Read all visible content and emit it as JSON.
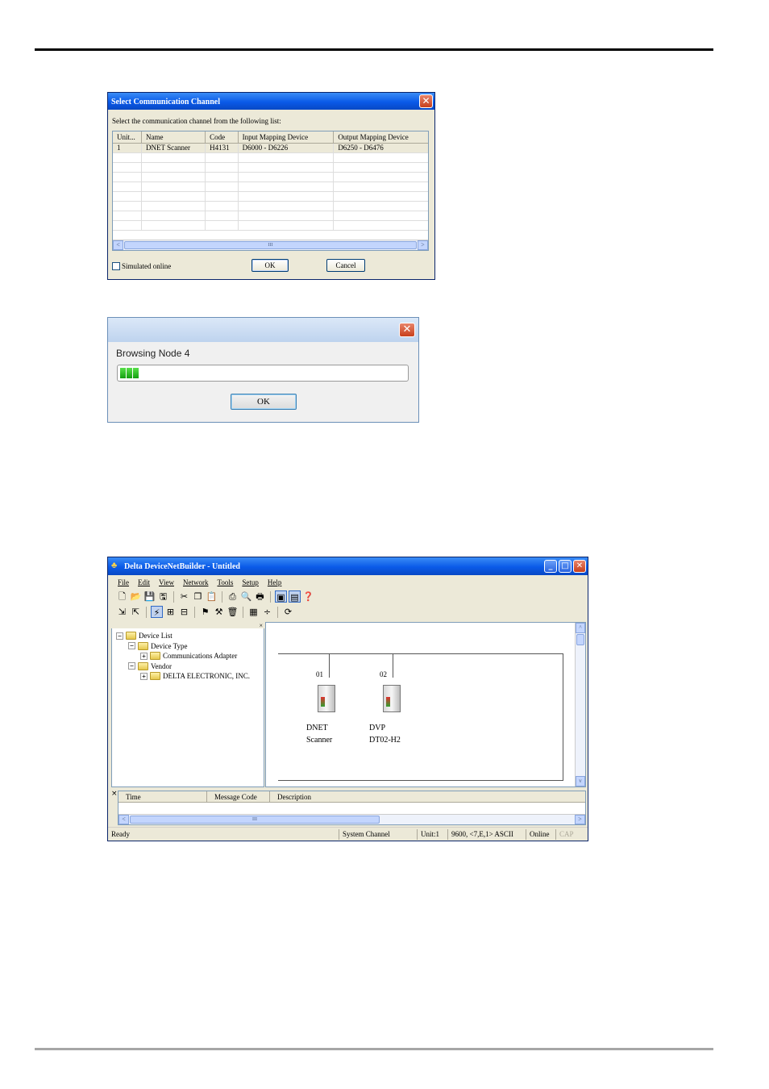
{
  "dialog1": {
    "title": "Select Communication Channel",
    "prompt": "Select the communication channel from the following list:",
    "columns": [
      "Unit...",
      "Name",
      "Code",
      "Input Mapping Device",
      "Output Mapping Device"
    ],
    "rows": [
      [
        "1",
        "DNET Scanner",
        "H4131",
        "D6000 - D6226",
        "D6250 - D6476"
      ]
    ],
    "simulated_label": "Simulated online",
    "simulated_checked": false,
    "ok_label": "OK",
    "cancel_label": "Cancel",
    "close_glyph": "✕",
    "scroll_left": "<",
    "scroll_right": ">",
    "scroll_thumb": "III"
  },
  "dialog2": {
    "title": "",
    "message": "Browsing Node 4",
    "progress_fraction": 0.07,
    "ok_label": "OK",
    "close_glyph": "✕"
  },
  "app": {
    "title": "Delta DeviceNetBuilder - Untitled",
    "icon_glyph": "♣",
    "window_buttons": {
      "minimize": "_",
      "maximize": "□",
      "close": "✕"
    },
    "menu": [
      "File",
      "Edit",
      "View",
      "Network",
      "Tools",
      "Setup",
      "Help"
    ],
    "panel_close": "×",
    "toolbar1": [
      {
        "name": "new-icon",
        "glyph": "🗋"
      },
      {
        "name": "open-icon",
        "glyph": "📂"
      },
      {
        "name": "save-icon",
        "glyph": "💾"
      },
      {
        "name": "save-as-icon",
        "glyph": "🖫"
      },
      {
        "sep": true
      },
      {
        "name": "cut-icon",
        "glyph": "✂"
      },
      {
        "name": "copy-icon",
        "glyph": "❐"
      },
      {
        "name": "paste-icon",
        "glyph": "📋"
      },
      {
        "sep": true
      },
      {
        "name": "print-setup-icon",
        "glyph": "⎙"
      },
      {
        "name": "print-preview-icon",
        "glyph": "🔍"
      },
      {
        "name": "print-icon",
        "glyph": "🖶"
      },
      {
        "sep": true
      },
      {
        "name": "device-list-toggle-icon",
        "glyph": "▣",
        "on": true
      },
      {
        "name": "message-window-toggle-icon",
        "glyph": "▤",
        "on": true
      },
      {
        "name": "help-icon",
        "glyph": "❓"
      }
    ],
    "toolbar2": [
      {
        "name": "upload-icon",
        "glyph": "⇲"
      },
      {
        "name": "download-icon",
        "glyph": "⇱"
      },
      {
        "sep": true
      },
      {
        "name": "online-icon",
        "glyph": "⚡",
        "on": true
      },
      {
        "name": "scan-network-icon",
        "glyph": "⊞"
      },
      {
        "name": "scanner-config-icon",
        "glyph": "⊟"
      },
      {
        "sep": true
      },
      {
        "name": "diagnose-icon",
        "glyph": "⚑"
      },
      {
        "name": "properties-icon",
        "glyph": "⚒"
      },
      {
        "name": "delete-node-icon",
        "glyph": "🗑"
      },
      {
        "sep": true
      },
      {
        "name": "grid-icon",
        "glyph": "▦"
      },
      {
        "name": "node-address-icon",
        "glyph": "÷"
      },
      {
        "sep": true
      },
      {
        "name": "refresh-icon",
        "glyph": "⟳"
      }
    ],
    "tree": [
      {
        "label": "Device List",
        "level": 0,
        "toggle": "−"
      },
      {
        "label": "Device Type",
        "level": 1,
        "toggle": "−"
      },
      {
        "label": "Communications Adapter",
        "level": 2,
        "toggle": "+"
      },
      {
        "label": "Vendor",
        "level": 1,
        "toggle": "−"
      },
      {
        "label": "DELTA ELECTRONIC, INC.",
        "level": 2,
        "toggle": "+"
      }
    ],
    "nodes": [
      {
        "address": "01",
        "line1": "DNET",
        "line2": "Scanner"
      },
      {
        "address": "02",
        "line1": "DVP",
        "line2": "DT02-H2"
      }
    ],
    "message_columns": [
      "Time",
      "Message Code",
      "Description"
    ],
    "scroll_up": "^",
    "scroll_down": "v",
    "status": [
      "Ready",
      "System Channel",
      "Unit:1",
      "9600, <7,E,1> ASCII",
      "Online",
      "CAP"
    ]
  },
  "colors": {
    "xp_title": "#0a5ae8",
    "progress_green": "#14a010",
    "dialog_face": "#ece9d8"
  }
}
